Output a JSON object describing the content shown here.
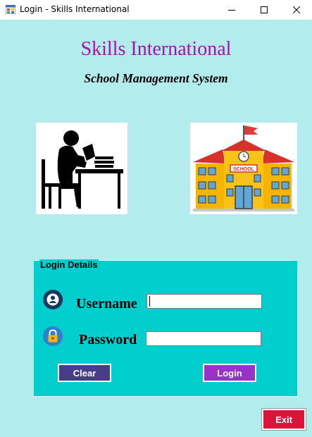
{
  "window": {
    "title": "Login - Skills International",
    "controls": {
      "minimize": "minimize-icon",
      "maximize": "maximize-icon",
      "close": "close-icon"
    }
  },
  "header": {
    "title": "Skills International",
    "subtitle": "School Management System",
    "title_color": "#a312b4"
  },
  "images": {
    "left": "student-studying-icon",
    "right": "school-building-icon",
    "school_sign": "SCHOOL"
  },
  "login_group": {
    "legend": "Login Details",
    "username_label": "Username",
    "username_value": "",
    "password_label": "Password",
    "password_value": "",
    "clear_label": "Clear",
    "login_label": "Login"
  },
  "footer": {
    "exit_label": "Exit"
  },
  "colors": {
    "background": "#b3ecec",
    "group_background": "#00cdcd",
    "clear_button": "#483d8b",
    "login_button": "#9932cc",
    "exit_button": "#dc143c"
  }
}
